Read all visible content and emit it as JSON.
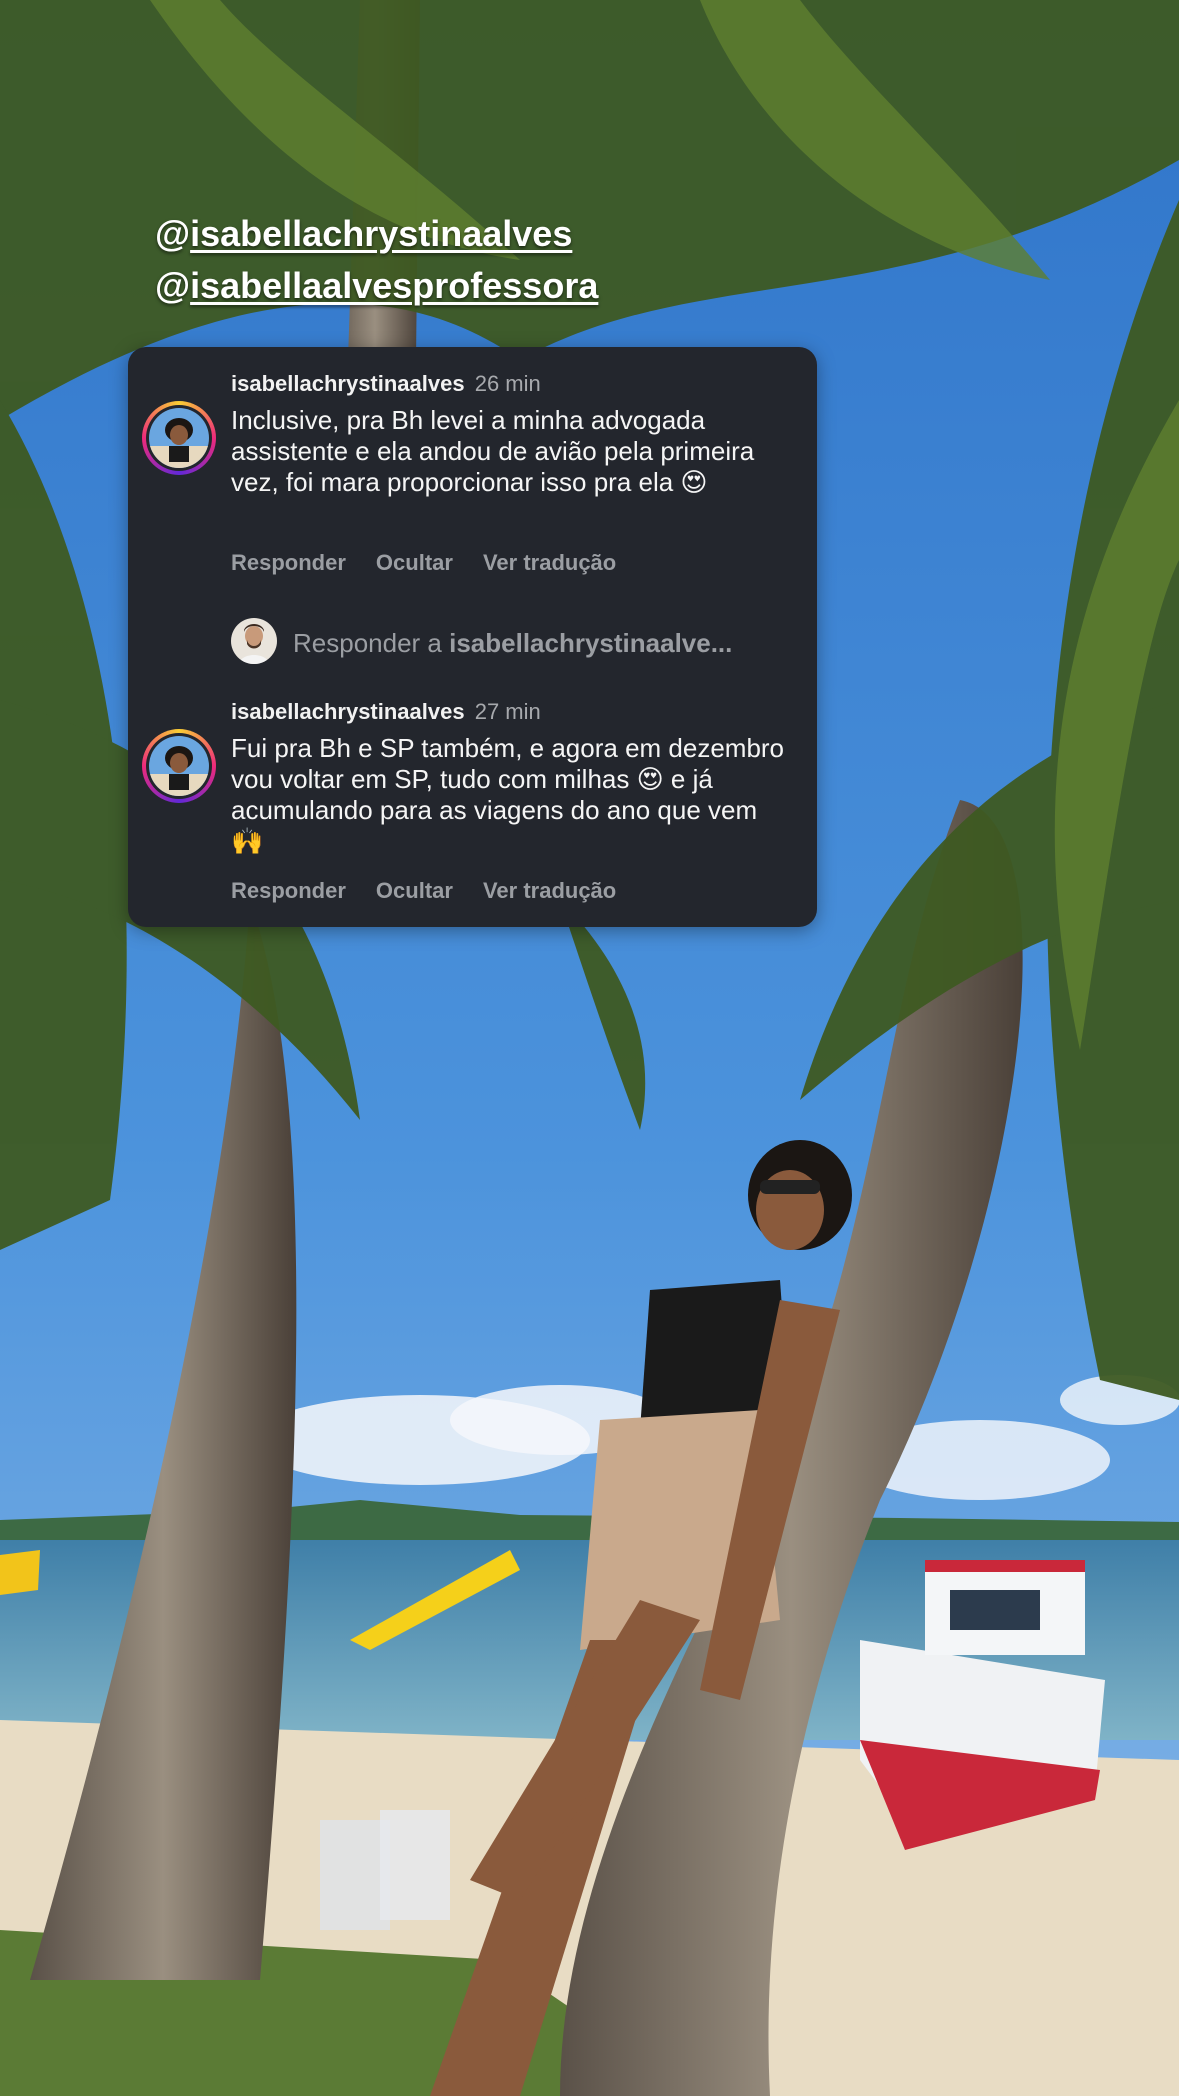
{
  "story": {
    "mentions": [
      {
        "at": "@",
        "handle": "isabellachrystinaalves"
      },
      {
        "at": "@",
        "handle": "isabellaalvesprofessora"
      }
    ]
  },
  "comments": [
    {
      "username": "isabellachrystinaalves",
      "time": "26 min",
      "text": "Inclusive, pra Bh levei a minha advogada assistente e ela andou de avião pela primeira vez, foi mara proporcionar isso pra ela 😍",
      "actions": {
        "reply": "Responder",
        "hide": "Ocultar",
        "translate": "Ver tradução"
      }
    },
    {
      "username": "isabellachrystinaalves",
      "time": "27 min",
      "text": "Fui pra Bh e SP também, e agora em dezembro vou voltar em SP, tudo com milhas 😍 e já acumulando para as viagens do ano que vem 🙌",
      "actions": {
        "reply": "Responder",
        "hide": "Ocultar",
        "translate": "Ver tradução"
      }
    }
  ],
  "reply_box": {
    "prefix": "Responder a ",
    "target": "isabellachrystinaalve..."
  },
  "colors": {
    "card_bg": "#23262d",
    "muted_text": "#9b9ea3",
    "sky": "#3a7fcf"
  }
}
